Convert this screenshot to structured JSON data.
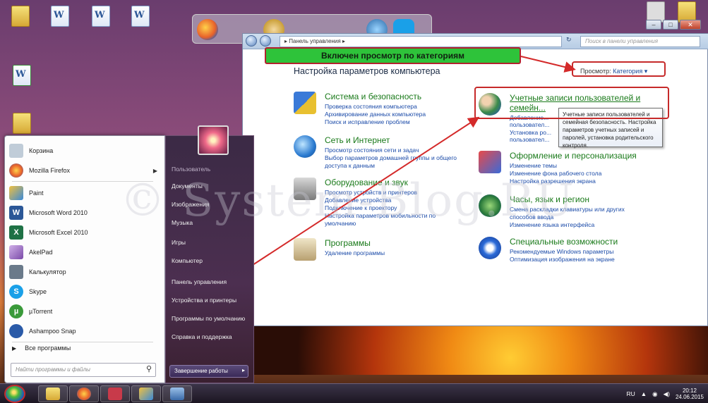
{
  "callout_text": "Включен просмотр по категориям",
  "watermark": "© System-Blog.RU",
  "control_panel": {
    "address": "▸ Панель управления ▸",
    "search_placeholder": "Поиск в панели управления",
    "title": "Настройка параметров компьютера",
    "view_label": "Просмотр:",
    "view_value": "Категория ▾",
    "categories_left": [
      {
        "title": "Система и безопасность",
        "links": [
          "Проверка состояния компьютера",
          "Архивирование данных компьютера",
          "Поиск и исправление проблем"
        ]
      },
      {
        "title": "Сеть и Интернет",
        "links": [
          "Просмотр состояния сети и задач",
          "Выбор параметров домашней группы и общего",
          "доступа к данным"
        ]
      },
      {
        "title": "Оборудование и звук",
        "links": [
          "Просмотр устройств и принтеров",
          "Добавление устройства",
          "Подключение к проектору",
          "Настройка параметров мобильности по",
          "умолчанию"
        ]
      },
      {
        "title": "Программы",
        "links": [
          "Удаление программы"
        ]
      }
    ],
    "categories_right": [
      {
        "title": "Учетные записи пользователей и",
        "title2": "семейн...",
        "links": [
          "Добавление...",
          "пользовател...",
          "Установка ро...",
          "пользовател..."
        ]
      },
      {
        "title": "Оформление и персонализация",
        "links": [
          "Изменение темы",
          "Изменение фона рабочего стола",
          "Настройка разрешения экрана"
        ]
      },
      {
        "title": "Часы, язык и регион",
        "links": [
          "Смена раскладки клавиатуры или других",
          "способов ввода",
          "Изменение языка интерфейса"
        ]
      },
      {
        "title": "Специальные возможности",
        "links": [
          "Рекомендуемые Windows параметры",
          "Оптимизация изображения на экране"
        ]
      }
    ],
    "tooltip": "Учетные записи пользователей и семейная безопасность. Настройка параметров учетных записей и паролей, установка родительского контроля."
  },
  "start_menu": {
    "programs": [
      "Корзина",
      "Mozilla Firefox",
      "Paint",
      "Microsoft Word 2010",
      "Microsoft Excel 2010",
      "AkelPad",
      "Калькулятор",
      "Skype",
      "µTorrent",
      "Ashampoo Snap"
    ],
    "all_programs": "Все программы",
    "search_placeholder": "Найти программы и файлы",
    "right_items": [
      "Документы",
      "Изображения",
      "Музыка",
      "Игры",
      "Компьютер",
      "Панель управления",
      "Устройства и принтеры",
      "Программы по умолчанию",
      "Справка и поддержка"
    ],
    "user_name": "Пользователь",
    "shutdown": "Завершение работы"
  },
  "taskbar": {
    "lang": "RU",
    "time": "20:12",
    "date": "24.06.2015"
  },
  "colors": {
    "callout_bg": "#2ec33a",
    "highlight_border": "#c62a2a",
    "category_title": "#1a7a1a",
    "link": "#1a4aa8"
  }
}
